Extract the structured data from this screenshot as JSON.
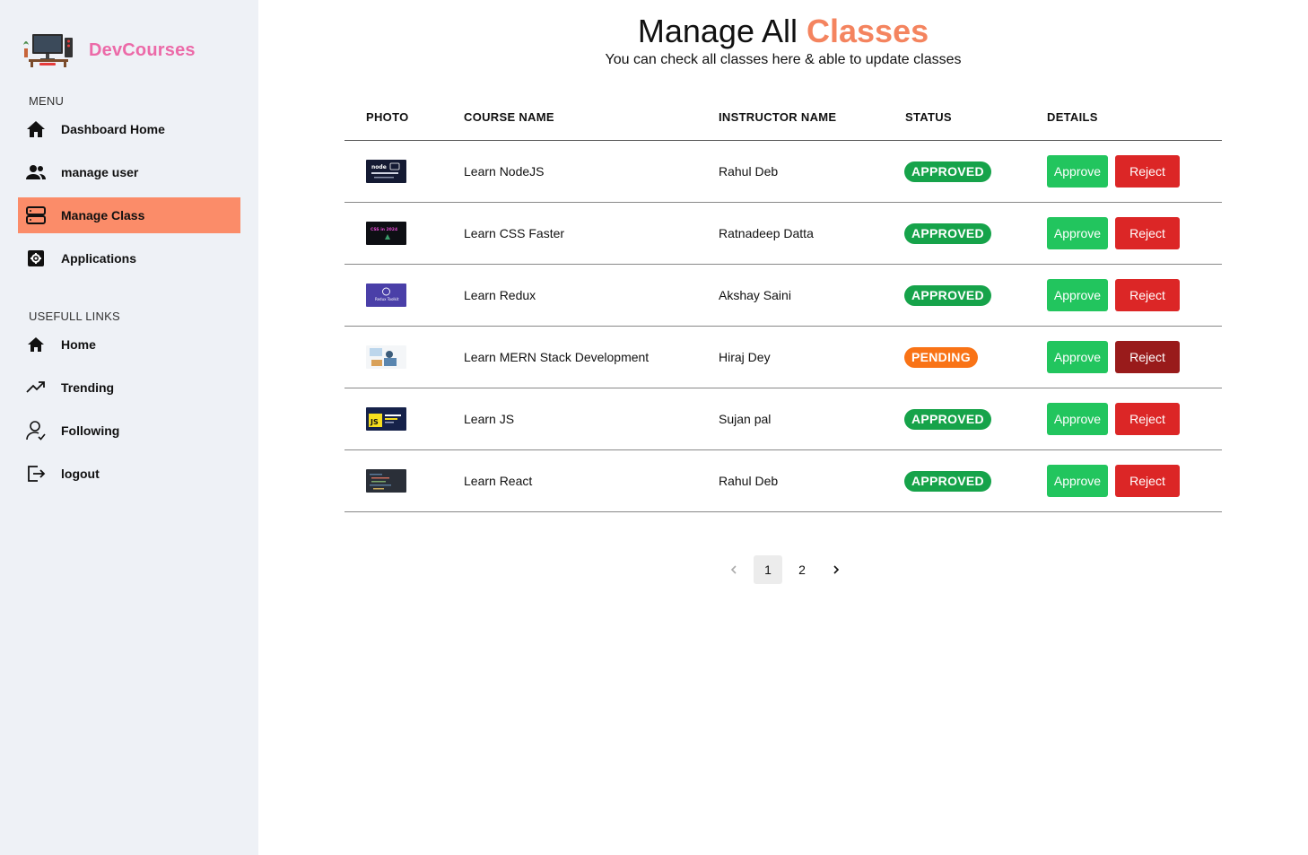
{
  "brand": {
    "name": "DevCourses",
    "logo_icon": "computer-desk-logo"
  },
  "menu": {
    "label": "MENU",
    "items": [
      {
        "label": "Dashboard Home",
        "icon": "home-icon"
      },
      {
        "label": "manage user",
        "icon": "users-icon"
      },
      {
        "label": "Manage Class",
        "icon": "server-icon",
        "active": true
      },
      {
        "label": "Applications",
        "icon": "gear-box-icon"
      }
    ]
  },
  "links": {
    "label": "USEFULL LINKS",
    "items": [
      {
        "label": "Home",
        "icon": "home-icon"
      },
      {
        "label": "Trending",
        "icon": "trending-up-icon"
      },
      {
        "label": "Following",
        "icon": "user-check-icon"
      },
      {
        "label": "logout",
        "icon": "logout-icon"
      }
    ]
  },
  "page": {
    "title_main": "Manage All ",
    "title_accent": "Classes",
    "subtitle": "You can check all classes here & able to update classes"
  },
  "table": {
    "headers": [
      "PHOTO",
      "COURSE NAME",
      "INSTRUCTOR NAME",
      "STATUS",
      "DETAILS"
    ],
    "approve_label": "Approve",
    "reject_label": "Reject",
    "rows": [
      {
        "course": "Learn NodeJS",
        "instructor": "Rahul Deb",
        "status": "APPROVED",
        "thumb": "node-thumbnail",
        "thumb_text": "node"
      },
      {
        "course": "Learn CSS Faster",
        "instructor": "Ratnadeep Datta",
        "status": "APPROVED",
        "thumb": "css-thumbnail",
        "thumb_text": "CSS in 2024"
      },
      {
        "course": "Learn Redux",
        "instructor": "Akshay Saini",
        "status": "APPROVED",
        "thumb": "redux-thumbnail",
        "thumb_text": "Redux Toolkit"
      },
      {
        "course": "Learn MERN Stack Development",
        "instructor": "Hiraj Dey",
        "status": "PENDING",
        "thumb": "mern-thumbnail",
        "thumb_text": ""
      },
      {
        "course": "Learn JS",
        "instructor": "Sujan pal",
        "status": "APPROVED",
        "thumb": "js-thumbnail",
        "thumb_text": "JS"
      },
      {
        "course": "Learn React",
        "instructor": "Rahul Deb",
        "status": "APPROVED",
        "thumb": "react-thumbnail",
        "thumb_text": ""
      }
    ]
  },
  "pagination": {
    "pages": [
      "1",
      "2"
    ],
    "current": "1"
  },
  "colors": {
    "brand": "#ec6aa8",
    "accent": "#f4845f",
    "active_nav": "#fb8c69",
    "approved": "#16a34a",
    "pending": "#f97316",
    "approve_button": "#22c55e",
    "reject_button": "#dc2626",
    "reject_button_active": "#991b1b",
    "sidebar_bg": "#eef1f6"
  }
}
